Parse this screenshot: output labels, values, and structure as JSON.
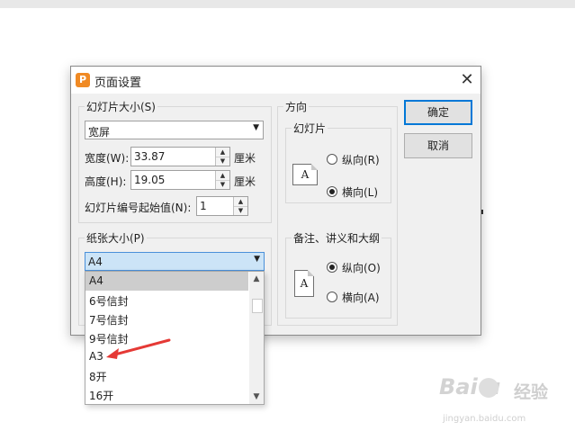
{
  "dialog": {
    "title": "页面设置",
    "app_icon_text": "P",
    "close_symbol": "✕"
  },
  "slide_size": {
    "group_label": "幻灯片大小(S)",
    "selected": "宽屏",
    "width_label": "宽度(W):",
    "width_value": "33.87",
    "width_unit": "厘米",
    "height_label": "高度(H):",
    "height_value": "19.05",
    "height_unit": "厘米",
    "start_number_label": "幻灯片编号起始值(N):",
    "start_number_value": "1"
  },
  "paper_size": {
    "group_label": "纸张大小(P)",
    "selected": "A4",
    "options": [
      "A4",
      "6号信封",
      "7号信封",
      "9号信封",
      "A3",
      "8开",
      "16开"
    ]
  },
  "orientation": {
    "group_label": "方向",
    "slides": {
      "label": "幻灯片",
      "portrait": "纵向(R)",
      "landscape": "横向(L)",
      "selected": "landscape",
      "icon_letter": "A"
    },
    "notes": {
      "label": "备注、讲义和大纲",
      "portrait": "纵向(O)",
      "landscape": "横向(A)",
      "selected": "portrait",
      "icon_letter": "A"
    }
  },
  "buttons": {
    "ok": "确定",
    "cancel": "取消"
  },
  "annotation": {
    "arrow_color": "#e53935"
  },
  "watermark": {
    "logo": "Bai  u",
    "jingyan": "经验",
    "url": "jingyan.baidu.com"
  }
}
